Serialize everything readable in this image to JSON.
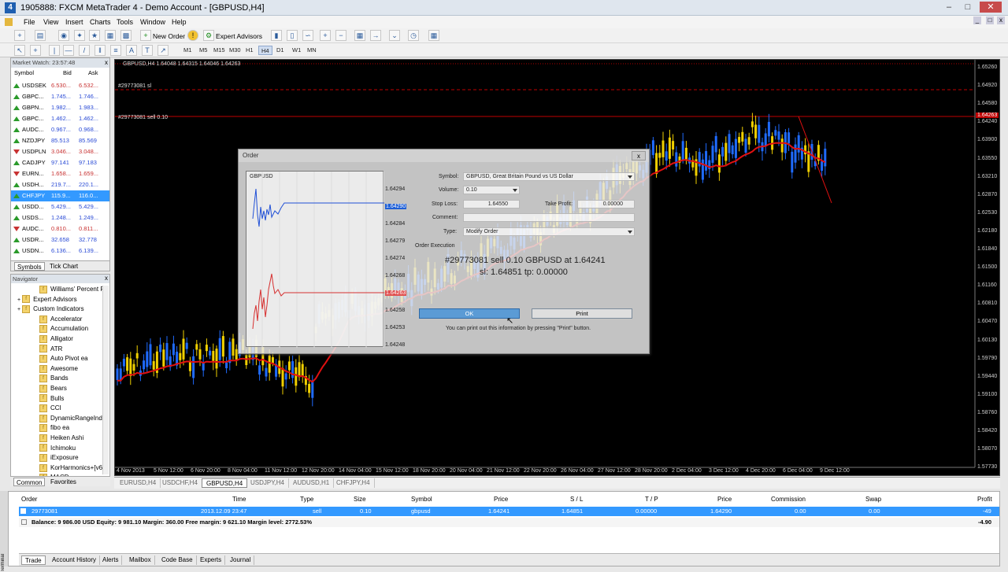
{
  "window": {
    "title": "1905888: FXCM MetaTrader 4 - Demo Account - [GBPUSD,H4]",
    "app_icon": "metatrader-icon"
  },
  "menu": [
    "File",
    "View",
    "Insert",
    "Charts",
    "Tools",
    "Window",
    "Help"
  ],
  "toolbar": {
    "new_order": "New Order",
    "expert_advisors": "Expert Advisors"
  },
  "timeframes": [
    "M1",
    "M5",
    "M15",
    "M30",
    "H1",
    "H4",
    "D1",
    "W1",
    "MN"
  ],
  "active_timeframe": "H4",
  "market_watch": {
    "header": "Market Watch: 23:57:48",
    "col_symbol": "Symbol",
    "col_bid": "Bid",
    "col_ask": "Ask",
    "rows": [
      {
        "symbol": "USDSEK",
        "bid": "6.530...",
        "ask": "6.532...",
        "dir": "up",
        "color": "#c83232"
      },
      {
        "symbol": "GBPC...",
        "bid": "1.745...",
        "ask": "1.746...",
        "dir": "up",
        "color": "#2a4bd6"
      },
      {
        "symbol": "GBPN...",
        "bid": "1.982...",
        "ask": "1.983...",
        "dir": "up",
        "color": "#2a4bd6"
      },
      {
        "symbol": "GBPC...",
        "bid": "1.462...",
        "ask": "1.462...",
        "dir": "up",
        "color": "#2a4bd6"
      },
      {
        "symbol": "AUDC...",
        "bid": "0.967...",
        "ask": "0.968...",
        "dir": "up",
        "color": "#2a4bd6"
      },
      {
        "symbol": "NZDJPY",
        "bid": "85.513",
        "ask": "85.569",
        "dir": "up",
        "color": "#2a4bd6"
      },
      {
        "symbol": "USDPLN",
        "bid": "3.046...",
        "ask": "3.048...",
        "dir": "dn",
        "color": "#c83232"
      },
      {
        "symbol": "CADJPY",
        "bid": "97.141",
        "ask": "97.183",
        "dir": "up",
        "color": "#2a4bd6"
      },
      {
        "symbol": "EURN...",
        "bid": "1.658...",
        "ask": "1.659...",
        "dir": "dn",
        "color": "#c83232"
      },
      {
        "symbol": "USDH...",
        "bid": "219.7...",
        "ask": "220.1...",
        "dir": "up",
        "color": "#2a4bd6"
      },
      {
        "symbol": "CHFJPY",
        "bid": "115.9...",
        "ask": "116.0...",
        "dir": "up",
        "color": "#ffffff",
        "selected": true
      },
      {
        "symbol": "USDD...",
        "bid": "5.429...",
        "ask": "5.429...",
        "dir": "up",
        "color": "#2a4bd6"
      },
      {
        "symbol": "USDS...",
        "bid": "1.248...",
        "ask": "1.249...",
        "dir": "up",
        "color": "#2a4bd6"
      },
      {
        "symbol": "AUDC...",
        "bid": "0.810...",
        "ask": "0.811...",
        "dir": "dn",
        "color": "#c83232"
      },
      {
        "symbol": "USDR...",
        "bid": "32.658",
        "ask": "32.778",
        "dir": "up",
        "color": "#2a4bd6"
      },
      {
        "symbol": "USDN...",
        "bid": "6.136...",
        "ask": "6.139...",
        "dir": "up",
        "color": "#2a4bd6"
      }
    ],
    "tabs": [
      "Symbols",
      "Tick Chart"
    ]
  },
  "navigator": {
    "header": "Navigator",
    "items": [
      {
        "label": "Williams' Percent R",
        "indent": 36
      },
      {
        "label": "Expert Advisors",
        "indent": 8,
        "folder": true
      },
      {
        "label": "Custom Indicators",
        "indent": 8,
        "folder": true
      },
      {
        "label": "Accelerator",
        "indent": 36
      },
      {
        "label": "Accumulation",
        "indent": 36
      },
      {
        "label": "Alligator",
        "indent": 36
      },
      {
        "label": "ATR",
        "indent": 36
      },
      {
        "label": "Auto Pivot ea",
        "indent": 36
      },
      {
        "label": "Awesome",
        "indent": 36
      },
      {
        "label": "Bands",
        "indent": 36
      },
      {
        "label": "Bears",
        "indent": 36
      },
      {
        "label": "Bulls",
        "indent": 36
      },
      {
        "label": "CCI",
        "indent": 36
      },
      {
        "label": "DynamicRangeInd",
        "indent": 36
      },
      {
        "label": "fibo ea",
        "indent": 36
      },
      {
        "label": "Heiken Ashi",
        "indent": 36
      },
      {
        "label": "Ichimoku",
        "indent": 36
      },
      {
        "label": "iExposure",
        "indent": 36
      },
      {
        "label": "KorHarmonics+[v6",
        "indent": 36
      },
      {
        "label": "MACD",
        "indent": 36
      }
    ],
    "tabs": [
      "Common",
      "Favorites"
    ]
  },
  "chart": {
    "header": "GBPUSD,H4  1.64048 1.64315 1.64046 1.64263",
    "sl_label": "#29773081 sl",
    "order_label": "#29773081 sell 0.10",
    "price_ticks": [
      "1.65260",
      "1.64920",
      "1.64580",
      "1.64240",
      "1.63900",
      "1.63550",
      "1.63210",
      "1.62870",
      "1.62530",
      "1.62180",
      "1.61840",
      "1.61500",
      "1.61160",
      "1.60810",
      "1.60470",
      "1.60130",
      "1.59790",
      "1.59440",
      "1.59100",
      "1.58760",
      "1.58420",
      "1.58070",
      "1.57730"
    ],
    "current_price": "1.64263",
    "time_ticks": [
      "4 Nov 2013",
      "5 Nov 12:00",
      "6 Nov 20:00",
      "8 Nov 04:00",
      "11 Nov 12:00",
      "12 Nov 20:00",
      "14 Nov 04:00",
      "15 Nov 12:00",
      "18 Nov 20:00",
      "20 Nov 04:00",
      "21 Nov 12:00",
      "22 Nov 20:00",
      "26 Nov 04:00",
      "27 Nov 12:00",
      "28 Nov 20:00",
      "2 Dec 04:00",
      "3 Dec 12:00",
      "4 Dec 20:00",
      "6 Dec 04:00",
      "9 Dec 12:00"
    ],
    "tabs": [
      "EURUSD,H4",
      "USDCHF,H4",
      "GBPUSD,H4",
      "USDJPY,H4",
      "AUDUSD,H1",
      "CHFJPY,H4"
    ],
    "active_tab": "GBPUSD,H4",
    "colors": {
      "bull": "#1f6bff",
      "bear": "#f0d000",
      "ma": "#e01010",
      "sl_line": "#c00000",
      "order_line": "#c00000"
    }
  },
  "order_dialog": {
    "title": "Order",
    "close": "x",
    "mini_symbol": "GBPUSD",
    "mini_ticks": [
      "1.64294",
      "1.64290",
      "1.64284",
      "1.64279",
      "1.64274",
      "1.64268",
      "1.64263",
      "1.64258",
      "1.64253",
      "1.64248"
    ],
    "symbol_label": "Symbol:",
    "symbol_value": "GBPUSD, Great Britain Pound vs US Dollar",
    "volume_label": "Volume:",
    "volume_value": "0.10",
    "sl_label": "Stop Loss:",
    "sl_value": "1.64550",
    "tp_label": "Take Profit:",
    "tp_value": "0.00000",
    "comment_label": "Comment:",
    "comment_value": "",
    "type_label": "Type:",
    "type_value": "Modify Order",
    "section": "Order Execution",
    "result_line1": "#29773081 sell 0.10 GBPUSD at 1.64241",
    "result_line2": "sl: 1.64851 tp: 0.00000",
    "ok": "OK",
    "print": "Print",
    "hint": "You can print out this information by pressing \"Print\" button."
  },
  "terminal": {
    "side_label": "Terminal",
    "headers": {
      "order": "Order",
      "time": "Time",
      "type": "Type",
      "size": "Size",
      "symbol": "Symbol",
      "price": "Price",
      "sl": "S / L",
      "tp": "T / P",
      "price2": "Price",
      "commission": "Commission",
      "swap": "Swap",
      "profit": "Profit"
    },
    "row": {
      "order": "29773081",
      "time": "2013.12.09 23:47",
      "type": "sell",
      "size": "0.10",
      "symbol": "gbpusd",
      "price": "1.64241",
      "sl": "1.64851",
      "tp": "0.00000",
      "price2": "1.64290",
      "commission": "0.00",
      "swap": "0.00",
      "profit": "-49"
    },
    "balance": "Balance: 9 986.00 USD  Equity: 9 981.10  Margin: 360.00  Free margin: 9 621.10  Margin level: 2772.53%",
    "balance_profit": "-4.90",
    "tabs": [
      "Trade",
      "Account History",
      "Alerts",
      "Mailbox",
      "Code Base",
      "Experts",
      "Journal"
    ]
  }
}
